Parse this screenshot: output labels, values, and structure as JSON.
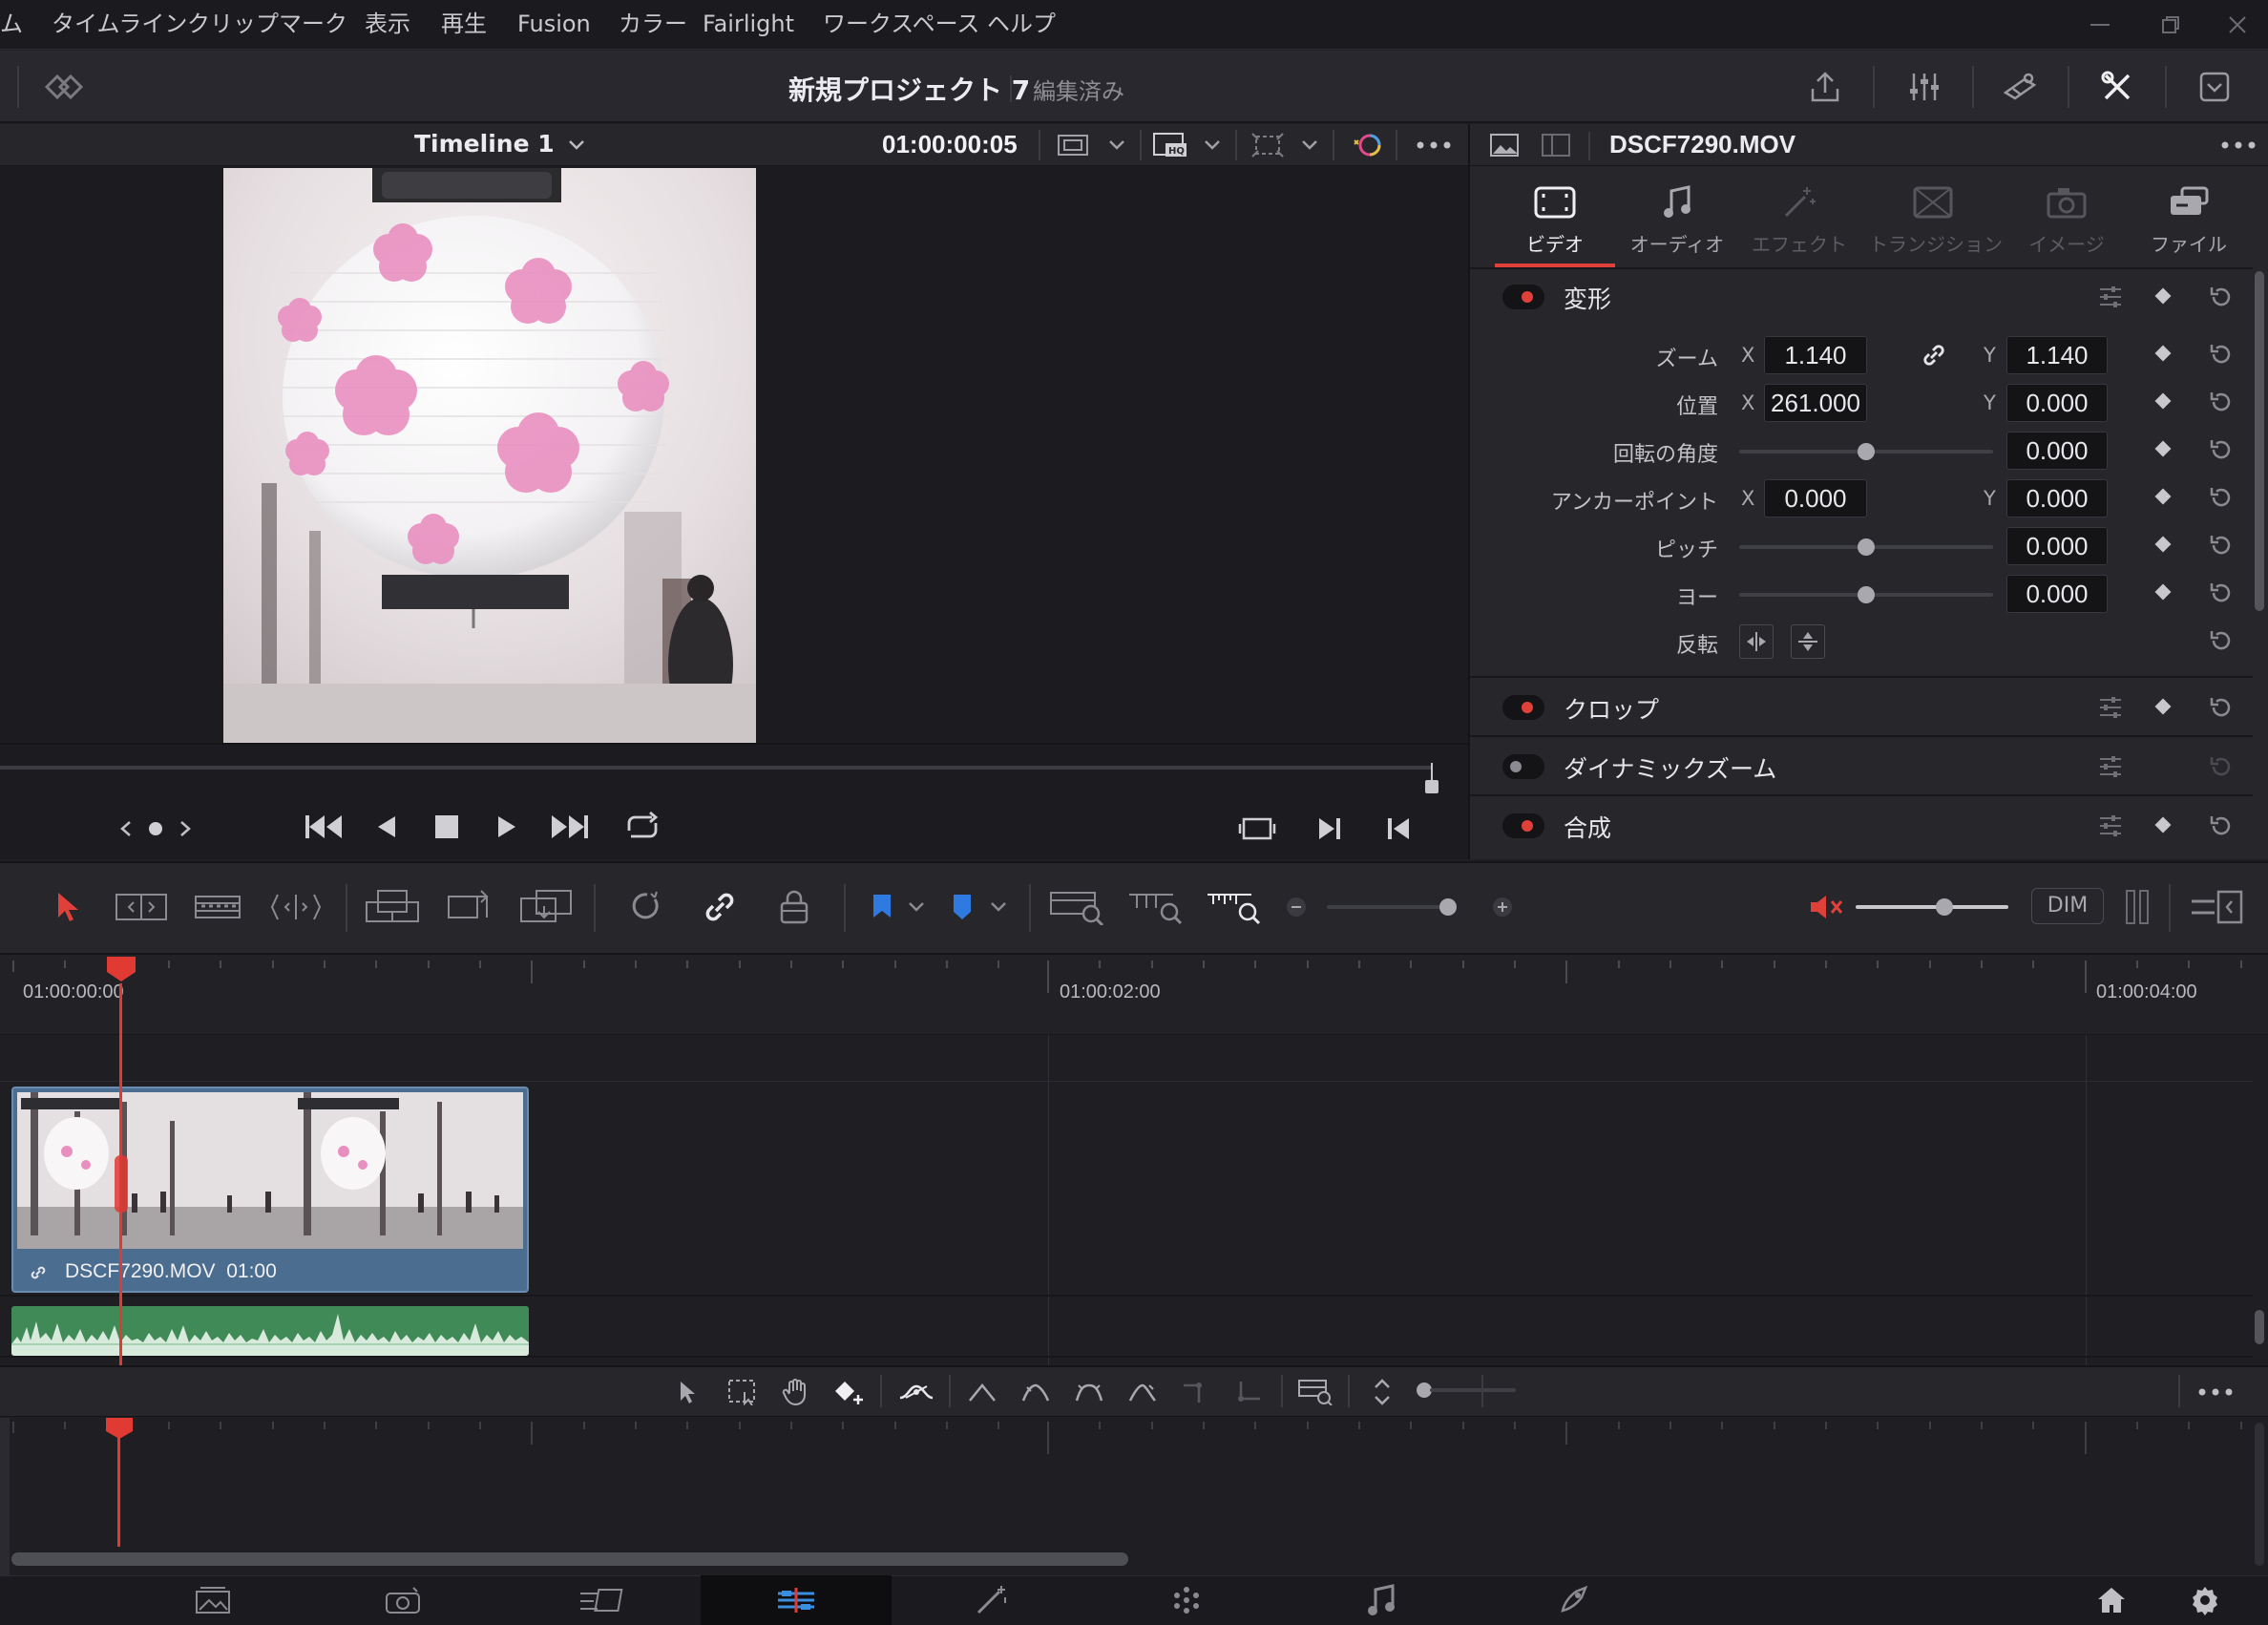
{
  "menu": [
    "ム",
    "タイムライン",
    "クリップ",
    "マーク",
    "表示",
    "再生",
    "Fusion",
    "カラー",
    "Fairlight",
    "ワークスペース",
    "ヘルプ"
  ],
  "project": {
    "name": "新規プロジェクト 7",
    "status": "編集済み"
  },
  "viewer": {
    "timeline_name": "Timeline 1",
    "timecode": "01:00:00:05"
  },
  "inspector": {
    "clip_name": "DSCF7290.MOV",
    "tabs": [
      "ビデオ",
      "オーディオ",
      "エフェクト",
      "トランジション",
      "イメージ",
      "ファイル"
    ],
    "active_tab": "ビデオ",
    "sections": {
      "transform": "変形",
      "crop": "クロップ",
      "dynamic_zoom": "ダイナミックズーム",
      "composite": "合成"
    },
    "labels": {
      "zoom": "ズーム",
      "position": "位置",
      "rotation": "回転の角度",
      "anchor": "アンカーポイント",
      "pitch": "ピッチ",
      "yaw": "ヨー",
      "flip": "反転",
      "x": "X",
      "y": "Y"
    },
    "values": {
      "zoom_x": "1.140",
      "zoom_y": "1.140",
      "pos_x": "261.000",
      "pos_y": "0.000",
      "rotation": "0.000",
      "anchor_x": "0.000",
      "anchor_y": "0.000",
      "pitch": "0.000",
      "yaw": "0.000"
    }
  },
  "toolbar": {
    "dim_label": "DIM"
  },
  "timeline": {
    "ruler": [
      "01:00:00:00",
      "01:00:02:00",
      "01:00:04:00"
    ],
    "clip_label": "DSCF7290.MOV  01:00"
  },
  "colors": {
    "accent_red": "#e0403a",
    "clip_blue": "#4b6d90",
    "audio_green": "#3f8a56",
    "playhead": "#e03a32"
  }
}
